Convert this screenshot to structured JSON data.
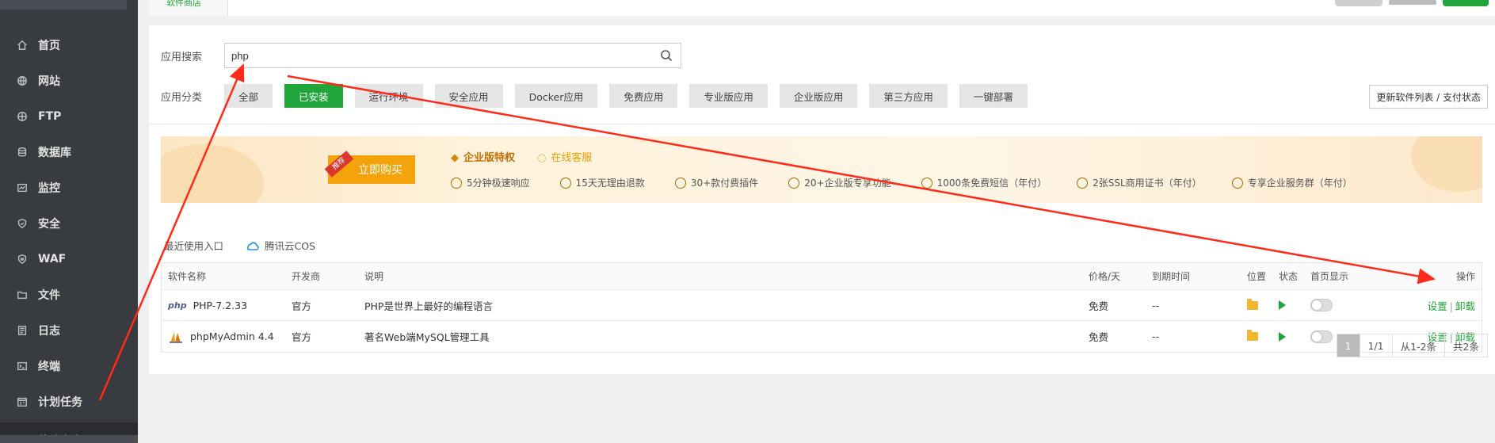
{
  "sidebar": {
    "items": [
      {
        "label": "首页",
        "icon": "home-icon"
      },
      {
        "label": "网站",
        "icon": "globe-icon"
      },
      {
        "label": "FTP",
        "icon": "ftp-icon"
      },
      {
        "label": "数据库",
        "icon": "database-icon"
      },
      {
        "label": "监控",
        "icon": "monitor-icon"
      },
      {
        "label": "安全",
        "icon": "shield-icon"
      },
      {
        "label": "WAF",
        "icon": "waf-shield-icon"
      },
      {
        "label": "文件",
        "icon": "folder-icon"
      },
      {
        "label": "日志",
        "icon": "log-icon"
      },
      {
        "label": "终端",
        "icon": "terminal-icon"
      },
      {
        "label": "计划任务",
        "icon": "calendar-icon"
      },
      {
        "label": "软件商店",
        "icon": "grid-icon",
        "active": true
      }
    ]
  },
  "topbar": {
    "tab_label": "软件商店"
  },
  "search": {
    "label": "应用搜索",
    "value": "php"
  },
  "categories": {
    "label": "应用分类",
    "items": [
      "全部",
      "已安装",
      "运行环境",
      "安全应用",
      "Docker应用",
      "免费应用",
      "专业版应用",
      "企业版应用",
      "第三方应用",
      "一键部署"
    ],
    "active": "已安装"
  },
  "refresh_button": "更新软件列表 / 支付状态",
  "banner": {
    "buy_button": "立即购买",
    "buy_tag": "推荐",
    "privilege_title": "企业版特权",
    "service_link": "在线客服",
    "features": [
      "5分钟极速响应",
      "15天无理由退款",
      "30+款付费插件",
      "20+企业版专享功能",
      "1000条免费短信（年付）",
      "2张SSL商用证书（年付）",
      "专享企业服务群（年付）"
    ]
  },
  "recent": {
    "label": "最近使用入口",
    "items": [
      "腾讯云COS"
    ]
  },
  "table": {
    "headers": [
      "软件名称",
      "开发商",
      "说明",
      "价格/天",
      "到期时间",
      "位置",
      "状态",
      "首页显示",
      "操作"
    ],
    "rows": [
      {
        "name": "PHP-7.2.33",
        "logo": "php-logo",
        "vendor": "官方",
        "desc": "PHP是世界上最好的编程语言",
        "price": "免费",
        "expire": "--",
        "op_settings": "设置",
        "op_sep": "|",
        "op_uninstall": "卸载"
      },
      {
        "name": "phpMyAdmin 4.4",
        "logo": "phpmyadmin-logo",
        "vendor": "官方",
        "desc": "著名Web端MySQL管理工具",
        "price": "免费",
        "expire": "--",
        "op_settings": "设置",
        "op_sep": "|",
        "op_uninstall": "卸载"
      }
    ]
  },
  "pager": {
    "current": "1",
    "pages": "1/1",
    "range": "从1-2条",
    "total": "共2条"
  },
  "colors": {
    "accent": "#20a53a",
    "sidebar_bg": "#383b40",
    "annotation": "#ff2a1a"
  }
}
